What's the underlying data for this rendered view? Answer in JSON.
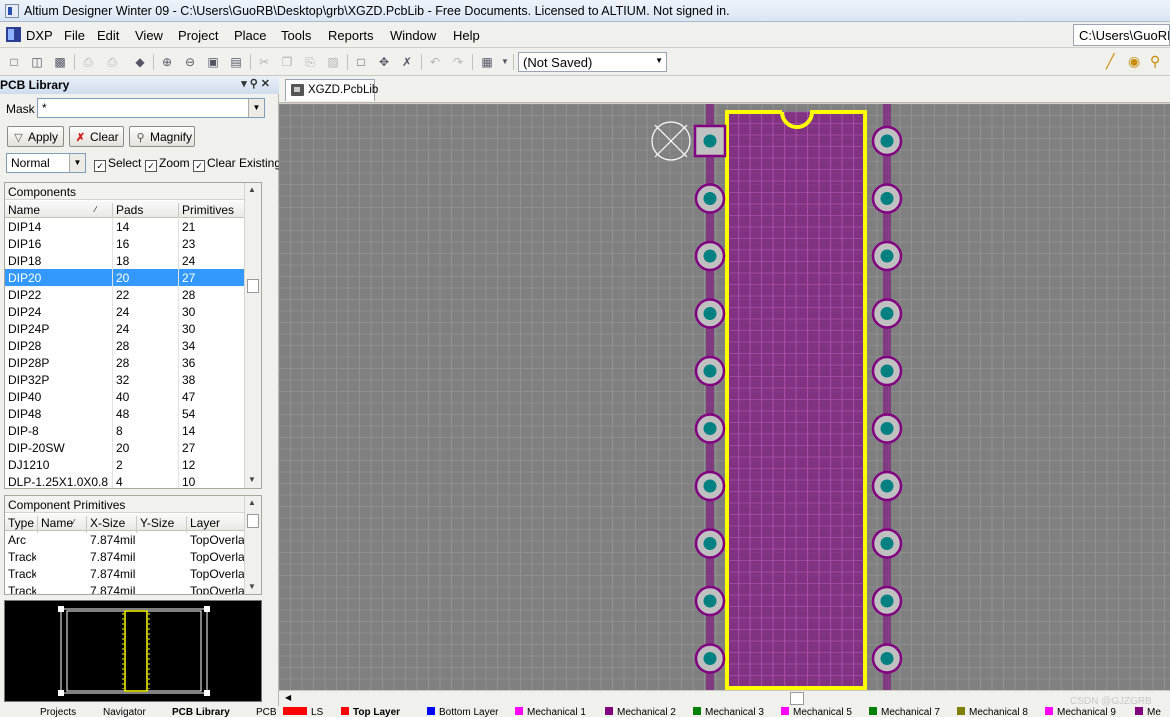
{
  "window": {
    "title": "Altium Designer Winter 09 - C:\\Users\\GuoRB\\Desktop\\grb\\XGZD.PcbLib - Free Documents. Licensed to ALTIUM. Not signed in."
  },
  "menu": {
    "items": [
      "DXP",
      "File",
      "Edit",
      "View",
      "Project",
      "Place",
      "Tools",
      "Reports",
      "Window",
      "Help"
    ],
    "path_box": "C:\\Users\\GuoRB"
  },
  "toolbar": {
    "save_state": "(Not Saved)"
  },
  "panel": {
    "title": "PCB Library",
    "mask_label": "Mask",
    "mask_value": "*",
    "apply_label": "Apply",
    "clear_label": "Clear",
    "magnify_label": "Magnify",
    "mode_value": "Normal",
    "select_label": "Select",
    "zoom_label": "Zoom",
    "clear_existing_label": "Clear Existing",
    "components": {
      "caption": "Components",
      "headers": [
        "Name",
        "Pads",
        "Primitives"
      ],
      "rows": [
        [
          "DIP14",
          "14",
          "21"
        ],
        [
          "DIP16",
          "16",
          "23"
        ],
        [
          "DIP18",
          "18",
          "24"
        ],
        [
          "DIP20",
          "20",
          "27"
        ],
        [
          "DIP22",
          "22",
          "28"
        ],
        [
          "DIP24",
          "24",
          "30"
        ],
        [
          "DIP24P",
          "24",
          "30"
        ],
        [
          "DIP28",
          "28",
          "34"
        ],
        [
          "DIP28P",
          "28",
          "36"
        ],
        [
          "DIP32P",
          "32",
          "38"
        ],
        [
          "DIP40",
          "40",
          "47"
        ],
        [
          "DIP48",
          "48",
          "54"
        ],
        [
          "DIP-8",
          "8",
          "14"
        ],
        [
          "DIP-20SW",
          "20",
          "27"
        ],
        [
          "DJ1210",
          "2",
          "12"
        ],
        [
          "DLP-1.25X1.0X0.8",
          "4",
          "10"
        ]
      ],
      "selected_index": 3
    },
    "primitives": {
      "caption": "Component Primitives",
      "headers": [
        "Type",
        "Name",
        "X-Size",
        "Y-Size",
        "Layer"
      ],
      "rows": [
        [
          "Arc",
          "",
          "7.874mil",
          "",
          "TopOverlay"
        ],
        [
          "Track",
          "",
          "7.874mil",
          "",
          "TopOverlay"
        ],
        [
          "Track",
          "",
          "7.874mil",
          "",
          "TopOverlay"
        ],
        [
          "Track",
          "",
          "7.874mil",
          "",
          "TopOverlay"
        ]
      ]
    },
    "bottom_tabs": [
      "Projects",
      "Navigator",
      "PCB Library",
      "PCB"
    ]
  },
  "document": {
    "tab_label": "XGZD.PcbLib"
  },
  "layers": [
    {
      "name": "LS",
      "color": "#ff0000"
    },
    {
      "name": "Top Layer",
      "color": "#ff0000"
    },
    {
      "name": "Bottom Layer",
      "color": "#0000ff"
    },
    {
      "name": "Mechanical 1",
      "color": "#ff00ff"
    },
    {
      "name": "Mechanical 2",
      "color": "#800080"
    },
    {
      "name": "Mechanical 3",
      "color": "#008000"
    },
    {
      "name": "Mechanical 5",
      "color": "#ff00ff"
    },
    {
      "name": "Mechanical 7",
      "color": "#008000"
    },
    {
      "name": "Mechanical 8",
      "color": "#808000"
    },
    {
      "name": "Mechanical 9",
      "color": "#ff00ff"
    },
    {
      "name": "Me",
      "color": "#800080"
    }
  ],
  "footprint": {
    "pin_count": 20,
    "pads_per_side": 10,
    "outline_color": "#ffff00",
    "pad_color": "#c0c0c0",
    "hole_color": "#008080",
    "solder_mask_color": "#800080",
    "grid_bg": "#808080"
  },
  "watermark": "CSDN @GJZGRB"
}
